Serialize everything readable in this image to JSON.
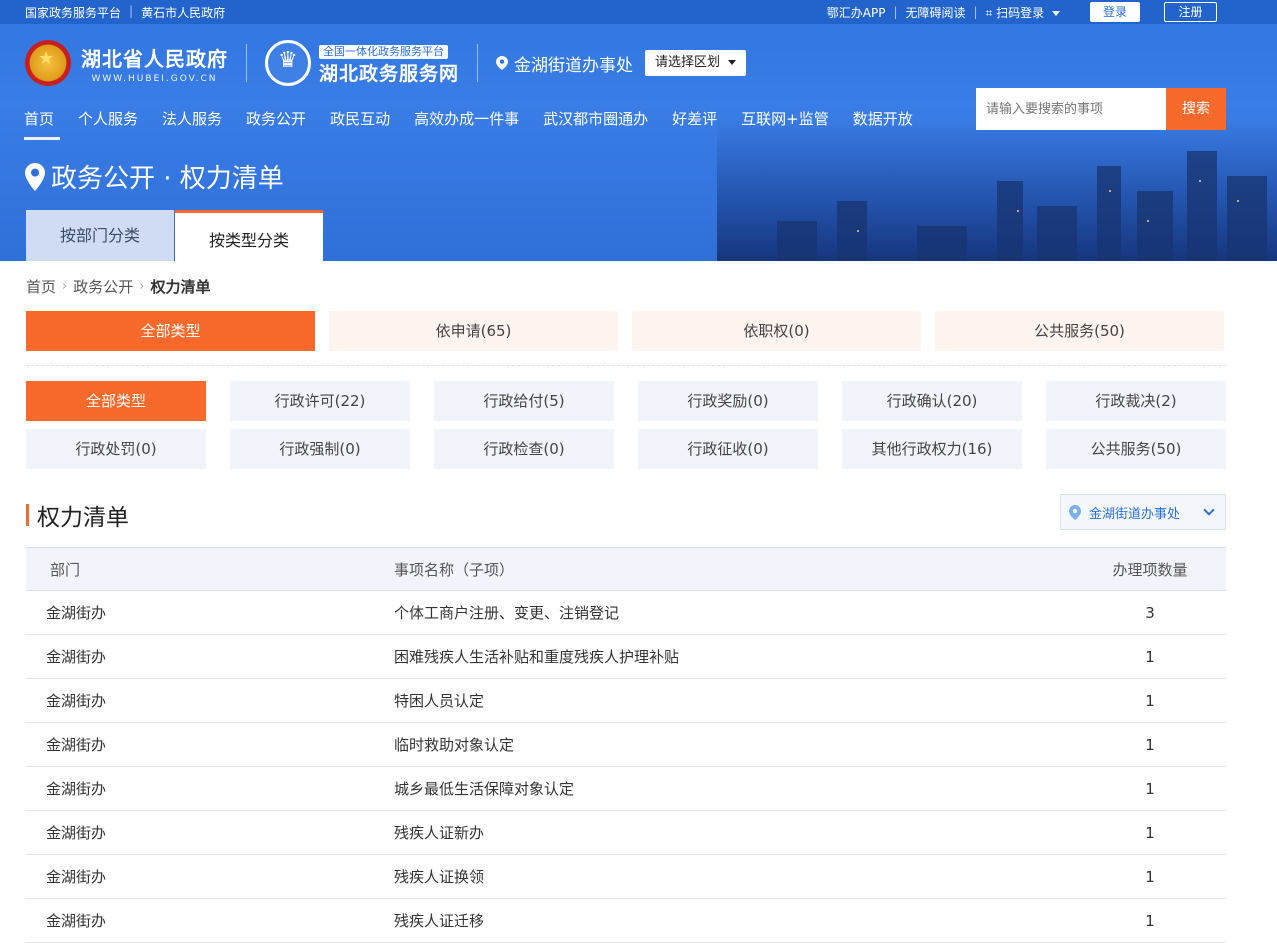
{
  "topbar": {
    "left_links": [
      "国家政务服务平台",
      "黄石市人民政府"
    ],
    "app_link": "鄂汇办APP",
    "accessibility_link": "无障碍阅读",
    "scan_login": "扫码登录",
    "login_button": "登录",
    "register_button": "注册"
  },
  "header": {
    "gov_title": "湖北省人民政府",
    "gov_url": "WWW.HUBEI.GOV.CN",
    "platform_tag": "全国一体化政务服务平台",
    "platform_title": "湖北政务服务网",
    "location_name": "金湖街道办事处",
    "region_select": "请选择区划"
  },
  "search": {
    "placeholder": "请输入要搜索的事项",
    "button": "搜索"
  },
  "nav": {
    "items": [
      "首页",
      "个人服务",
      "法人服务",
      "政务公开",
      "政民互动",
      "高效办成一件事",
      "武汉都市圈通办",
      "好差评",
      "互联网+监管",
      "数据开放"
    ],
    "active": "首页"
  },
  "page": {
    "title": "政务公开 · 权力清单",
    "tabs": [
      {
        "label": "按部门分类",
        "active": false
      },
      {
        "label": "按类型分类",
        "active": true
      }
    ]
  },
  "breadcrumb": [
    "首页",
    "政务公开",
    "权力清单"
  ],
  "type_filters": [
    {
      "label": "全部类型",
      "active": true
    },
    {
      "label": "依申请(65)",
      "active": false
    },
    {
      "label": "依职权(0)",
      "active": false
    },
    {
      "label": "公共服务(50)",
      "active": false
    }
  ],
  "sub_filters": [
    {
      "label": "全部类型",
      "active": true
    },
    {
      "label": "行政许可(22)",
      "active": false
    },
    {
      "label": "行政给付(5)",
      "active": false
    },
    {
      "label": "行政奖励(0)",
      "active": false
    },
    {
      "label": "行政确认(20)",
      "active": false
    },
    {
      "label": "行政裁决(2)",
      "active": false
    },
    {
      "label": "行政处罚(0)",
      "active": false
    },
    {
      "label": "行政强制(0)",
      "active": false
    },
    {
      "label": "行政检查(0)",
      "active": false
    },
    {
      "label": "行政征收(0)",
      "active": false
    },
    {
      "label": "其他行政权力(16)",
      "active": false
    },
    {
      "label": "公共服务(50)",
      "active": false
    }
  ],
  "section": {
    "title": "权力清单",
    "region_dropdown": "金湖街道办事处"
  },
  "table": {
    "headers": [
      "部门",
      "事项名称（子项）",
      "办理项数量"
    ],
    "rows": [
      {
        "dept": "金湖街办",
        "name": "个体工商户注册、变更、注销登记",
        "count": "3"
      },
      {
        "dept": "金湖街办",
        "name": "困难残疾人生活补贴和重度残疾人护理补贴",
        "count": "1"
      },
      {
        "dept": "金湖街办",
        "name": "特困人员认定",
        "count": "1"
      },
      {
        "dept": "金湖街办",
        "name": "临时救助对象认定",
        "count": "1"
      },
      {
        "dept": "金湖街办",
        "name": "城乡最低生活保障对象认定",
        "count": "1"
      },
      {
        "dept": "金湖街办",
        "name": "残疾人证新办",
        "count": "1"
      },
      {
        "dept": "金湖街办",
        "name": "残疾人证换领",
        "count": "1"
      },
      {
        "dept": "金湖街办",
        "name": "残疾人证迁移",
        "count": "1"
      }
    ]
  },
  "colors": {
    "brand_blue": "#2f6fd8",
    "accent_orange": "#f76a2c"
  }
}
